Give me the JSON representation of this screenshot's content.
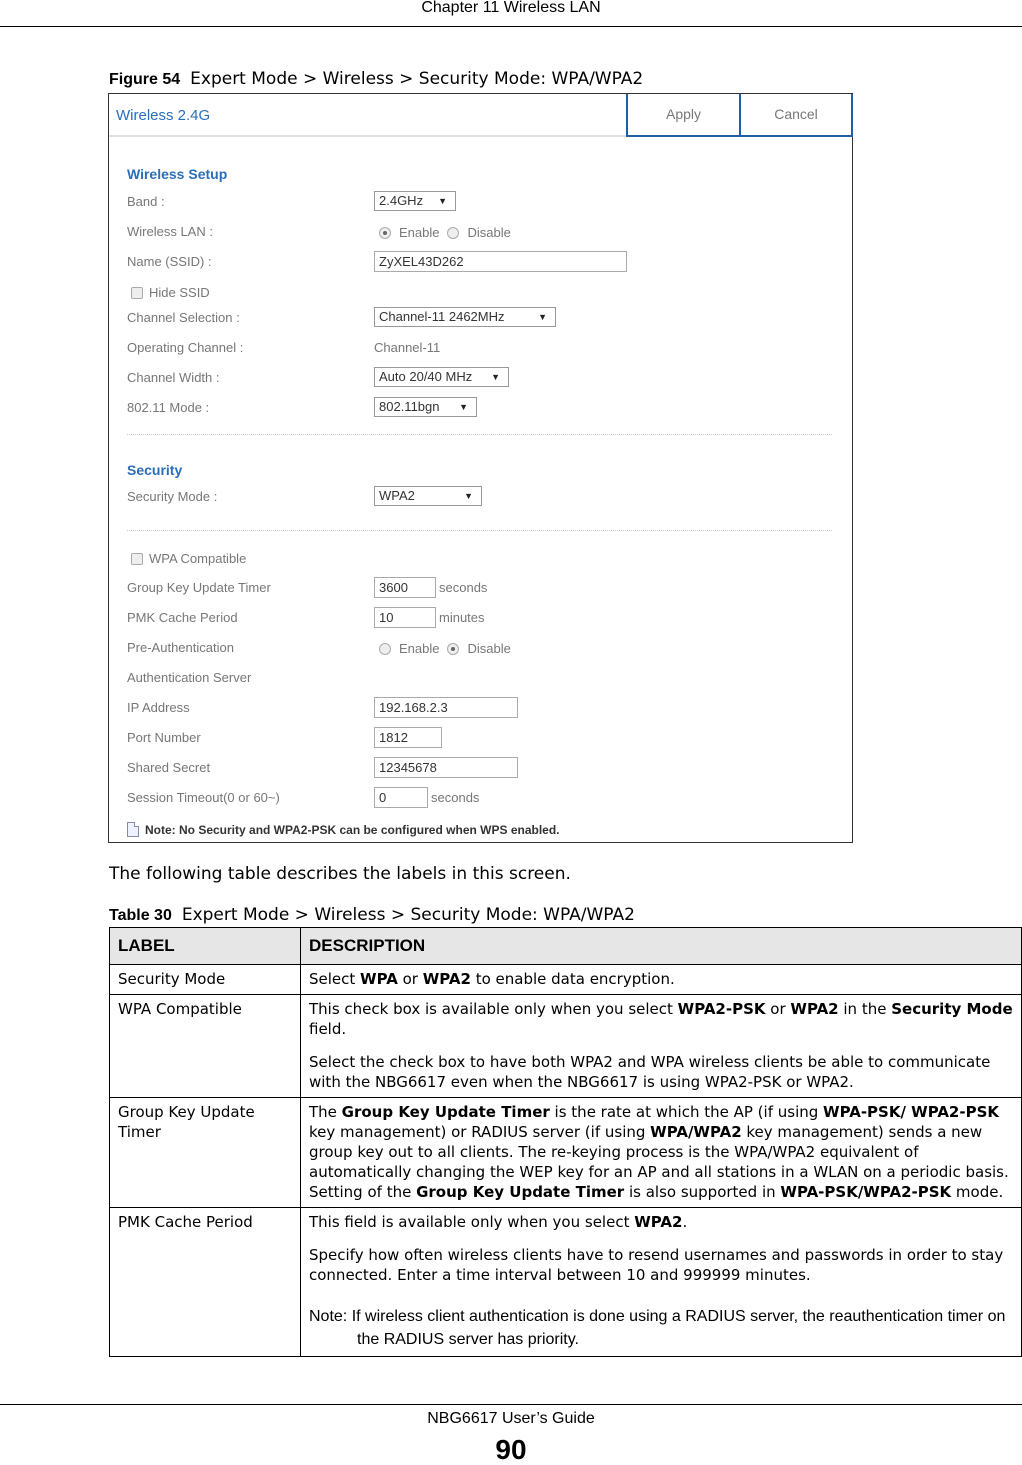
{
  "page": {
    "chapter": "Chapter 11 Wireless LAN",
    "guide": "NBG6617 User’s Guide",
    "page_number": "90"
  },
  "figure": {
    "number": "Figure 54",
    "caption": "Expert Mode > Wireless > Security Mode: WPA/WPA2",
    "title": "Wireless 2.4G",
    "apply": "Apply",
    "cancel": "Cancel",
    "wireless_setup": {
      "heading": "Wireless Setup",
      "band_label": "Band :",
      "band_value": "2.4GHz",
      "wlan_label": "Wireless LAN :",
      "enable": "Enable",
      "disable": "Disable",
      "wlan_selected": "Enable",
      "ssid_label": "Name (SSID) :",
      "ssid_value": "ZyXEL43D262",
      "hide_ssid": "Hide SSID",
      "hide_ssid_checked": false,
      "channel_sel_label": "Channel Selection :",
      "channel_sel_value": "Channel-11 2462MHz",
      "op_channel_label": "Operating Channel :",
      "op_channel_value": "Channel-11",
      "width_label": "Channel Width :",
      "width_value": "Auto 20/40 MHz",
      "mode_label": "802.11 Mode :",
      "mode_value": "802.11bgn"
    },
    "security": {
      "heading": "Security",
      "mode_label": "Security Mode :",
      "mode_value": "WPA2",
      "wpa_compatible": "WPA Compatible",
      "wpa_compatible_checked": false,
      "gkut_label": "Group Key Update Timer",
      "gkut_value": "3600",
      "gkut_unit": "seconds",
      "pmk_label": "PMK Cache Period",
      "pmk_value": "10",
      "pmk_unit": "minutes",
      "preauth_label": "Pre-Authentication",
      "enable": "Enable",
      "disable": "Disable",
      "preauth_selected": "Disable",
      "auth_server_label": "Authentication Server",
      "ip_label": "IP Address",
      "ip_value": "192.168.2.3",
      "port_label": "Port Number",
      "port_value": "1812",
      "secret_label": "Shared Secret",
      "secret_value": "12345678",
      "timeout_label": "Session Timeout(0 or 60~)",
      "timeout_value": "0",
      "timeout_unit": "seconds"
    },
    "note": "Note: No Security and WPA2-PSK can be configured when WPS enabled.",
    "colors": {
      "accent": "#2a6ebb",
      "button_border": "#1f5fa8",
      "label": "#777777"
    }
  },
  "intro": "The following table describes the labels in this screen.",
  "table": {
    "number": "Table 30",
    "caption": "Expert Mode > Wireless > Security Mode: WPA/WPA2",
    "headers": [
      "LABEL",
      "DESCRIPTION"
    ],
    "rows": [
      {
        "label": "Security Mode",
        "desc": [
          [
            "Select ",
            "WPA",
            " or ",
            "WPA2",
            " to enable data encryption."
          ]
        ]
      },
      {
        "label": "WPA Compatible",
        "desc": [
          [
            "This check box is available only when you select ",
            "WPA2-PSK",
            " or ",
            "WPA2",
            " in the ",
            "Security Mode",
            " field."
          ],
          [
            "Select the check box to have both WPA2 and WPA wireless clients be able to communicate with the NBG6617 even when the NBG6617 is using WPA2-PSK or WPA2."
          ]
        ]
      },
      {
        "label": "Group Key Update Timer",
        "desc": [
          [
            "The ",
            "Group Key Update Timer",
            " is the rate at which the AP (if using ",
            "WPA-PSK/ WPA2-PSK",
            " key management) or RADIUS server (if using ",
            "WPA/WPA2",
            " key management) sends a new group key out to all clients. The re-keying process is the WPA/WPA2 equivalent of automatically changing the WEP key for an AP and all stations in a WLAN on a periodic basis. Setting of the ",
            "Group Key Update Timer",
            " is also supported in ",
            "WPA-PSK/WPA2-PSK",
            " mode."
          ]
        ]
      },
      {
        "label": "PMK Cache Period",
        "desc": [
          [
            "This field is available only when you select ",
            "WPA2",
            "."
          ],
          [
            "Specify how often wireless clients have to resend usernames and passwords in order to stay connected. Enter a time interval between 10 and 999999 minutes."
          ]
        ],
        "note": "Note: If wireless client authentication is done using a RADIUS server, the reauthentication timer on the RADIUS server has priority."
      }
    ]
  }
}
